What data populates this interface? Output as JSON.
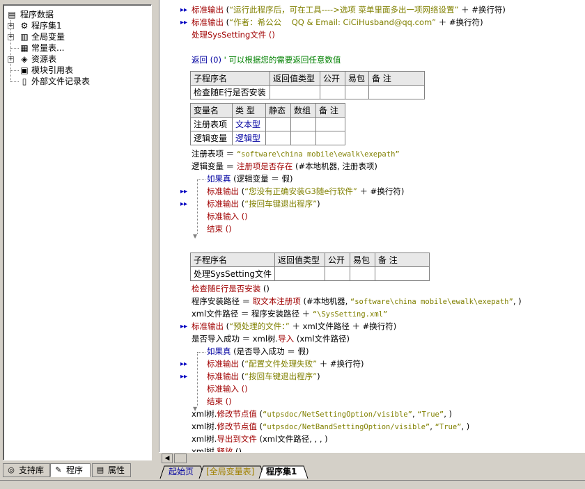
{
  "tree": {
    "root_label": "程序数据",
    "items": [
      {
        "label": "程序集1",
        "icon": "program-set-icon",
        "expandable": true
      },
      {
        "label": "全局变量",
        "icon": "global-var-icon",
        "expandable": true
      },
      {
        "label": "常量表...",
        "icon": "constant-icon",
        "expandable": false
      },
      {
        "label": "资源表",
        "icon": "resource-icon",
        "expandable": true
      },
      {
        "label": "模块引用表",
        "icon": "module-icon",
        "expandable": false
      },
      {
        "label": "外部文件记录表",
        "icon": "file-icon",
        "expandable": false
      }
    ]
  },
  "left_tabs": {
    "support": "支持库",
    "program": "程序",
    "property": "属性"
  },
  "code": {
    "line1_fn": "标准输出",
    "line1_str": "“运行此程序后，可在工具---->选项 菜单里面多出一项网络设置”",
    "line1_tail": " ＋ #换行符)",
    "line2_fn": "标准输出",
    "line2_str": "“作者：希公公    QQ & Email: CiCiHusband@qq.com”",
    "line2_tail": " ＋ #换行符)",
    "line3": "处理SysSetting文件 ()",
    "return_kw": "返回 (0)",
    "return_cm": "' 可以根据您的需要返回任意数值",
    "sub1": {
      "headers": [
        "子程序名",
        "返回值类型",
        "公开",
        "易包",
        "备 注"
      ],
      "row": [
        "检查随E行是否安装",
        "",
        "",
        "",
        ""
      ]
    },
    "vars1": {
      "headers": [
        "变量名",
        "类 型",
        "静态",
        "数组",
        "备 注"
      ],
      "rows": [
        [
          "注册表项",
          "文本型",
          "",
          "",
          ""
        ],
        [
          "逻辑变量",
          "逻辑型",
          "",
          "",
          ""
        ]
      ]
    },
    "assign1_a": "注册表项 ＝ ",
    "assign1_str": "“software\\china mobile\\ewalk\\exepath”",
    "assign2_a": "逻辑变量 ＝ ",
    "assign2_fn": "注册项是否存在",
    "assign2_b": " (#本地机器, 注册表项)",
    "if1_kw": "如果真",
    "if1_cond": " (逻辑变量 ＝ 假)",
    "if1_l1_fn": "标准输出",
    "if1_l1_str": "“您没有正确安装G3随e行软件”",
    "if1_l1_tail": " ＋ #换行符)",
    "if1_l2_fn": "标准输出",
    "if1_l2_str": "“按回车键退出程序”",
    "if1_l2_tail": ")",
    "if1_l3": "标准输入 ()",
    "if1_l4": "结束 ()",
    "sub2": {
      "headers": [
        "子程序名",
        "返回值类型",
        "公开",
        "易包",
        "备 注"
      ],
      "row": [
        "处理SysSetting文件",
        "",
        "",
        "",
        ""
      ]
    },
    "b1_fn": "检查随E行是否安装",
    "b1_tail": " ()",
    "b2_a": "程序安装路径 ＝ ",
    "b2_fn": "取文本注册项",
    "b2_b": " (#本地机器, ",
    "b2_str": "“software\\china mobile\\ewalk\\exepath”",
    "b2_c": ", )",
    "b3_a": "xml文件路径 ＝ 程序安装路径 ＋ ",
    "b3_str": "“\\SysSetting.xml”",
    "b4_fn": "标准输出",
    "b4_str": "“预处理的文件：”",
    "b4_tail": " ＋ xml文件路径 ＋ #换行符)",
    "b5_a": "是否导入成功 ＝ xml树.",
    "b5_fn": "导入",
    "b5_b": " (xml文件路径)",
    "if2_kw": "如果真",
    "if2_cond": " (是否导入成功 ＝ 假)",
    "if2_l1_fn": "标准输出",
    "if2_l1_str": "“配置文件处理失败”",
    "if2_l1_tail": " ＋ #换行符)",
    "if2_l2_fn": "标准输出",
    "if2_l2_str": "“按回车键退出程序”",
    "if2_l2_tail": ")",
    "if2_l3": "标准输入 ()",
    "if2_l4": "结束 ()",
    "c1_a": "xml树.",
    "c1_fn": "修改节点值",
    "c1_b": " (",
    "c1_s1": "“utpsdoc/NetSettingOption/visible”",
    "c1_s2": "“True”",
    "c2_a": "xml树.",
    "c2_fn": "修改节点值",
    "c2_b": " (",
    "c2_s1": "“utpsdoc/NetBandSettingOption/visible”",
    "c2_s2": "“True”",
    "c3_a": "xml树.",
    "c3_fn": "导出到文件",
    "c3_b": " (xml文件路径, , , )",
    "c4_a": "xml树.",
    "c4_fn": "释放",
    "c4_b": " ()"
  },
  "bottom_tabs": {
    "start": "起始页",
    "global": "[全局变量表]",
    "active": "程序集1"
  },
  "colors": {
    "function": "#a00000",
    "keyword": "#0000a0",
    "string": "#808000",
    "comment": "#008000"
  }
}
